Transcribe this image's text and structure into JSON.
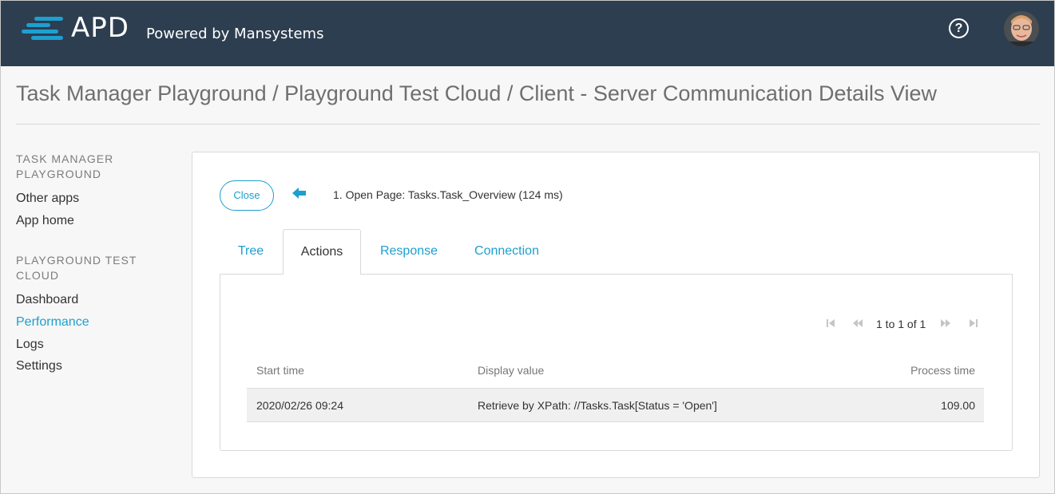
{
  "header": {
    "logo_text": "APD",
    "powered_by": "Powered by Mansystems",
    "help_label": "?",
    "colors": {
      "background": "#2d3e50",
      "logo_stripe": "#1d9fcf"
    }
  },
  "page_title": "Task Manager Playground / Playground Test Cloud / Client - Server Communication Details View",
  "sidebar": {
    "sections": [
      {
        "title_line1": "TASK MANAGER",
        "title_line2": "PLAYGROUND",
        "items": [
          {
            "label": "Other apps"
          },
          {
            "label": "App home"
          }
        ]
      },
      {
        "title_line1": "PLAYGROUND TEST",
        "title_line2": "CLOUD",
        "items": [
          {
            "label": "Dashboard"
          },
          {
            "label": "Performance",
            "active": true
          },
          {
            "label": "Logs"
          },
          {
            "label": "Settings"
          }
        ]
      }
    ]
  },
  "details": {
    "close_label": "Close",
    "back_icon": "arrow-left-icon",
    "step_label": "1. Open Page: Tasks.Task_Overview (124 ms)",
    "tabs": [
      {
        "label": "Tree"
      },
      {
        "label": "Actions",
        "active": true
      },
      {
        "label": "Response"
      },
      {
        "label": "Connection"
      }
    ],
    "pager": {
      "text": "1 to 1 of 1"
    },
    "table": {
      "columns": [
        "Start time",
        "Display value",
        "Process time"
      ],
      "rows": [
        {
          "start_time": "2020/02/26 09:24",
          "display_value": "Retrieve by XPath: //Tasks.Task[Status = 'Open']",
          "process_time": "109.00"
        }
      ]
    }
  },
  "accent_color": "#1d9fcf"
}
